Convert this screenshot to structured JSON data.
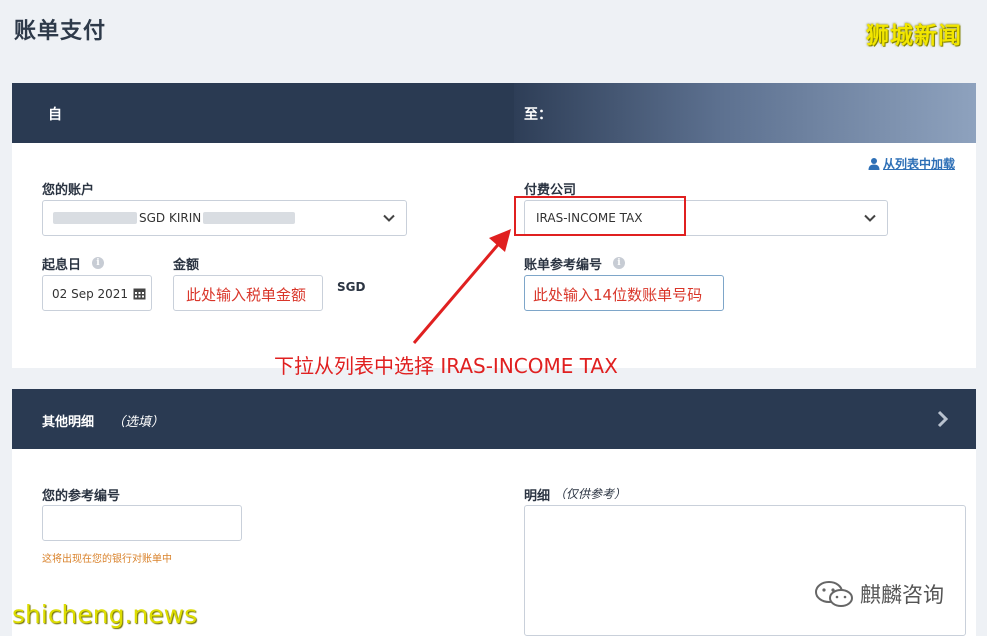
{
  "page_title": "账单支付",
  "watermark_top": "狮城新闻",
  "from_section": {
    "label": "自"
  },
  "to_section": {
    "label": "至："
  },
  "add_from_list_link": "从列表中加载",
  "account": {
    "label": "您的账户",
    "value_visible": "SGD KIRIN"
  },
  "payee": {
    "label": "付费公司",
    "value": "IRAS-INCOME TAX"
  },
  "start_date": {
    "label": "起息日",
    "value": "02 Sep 2021"
  },
  "amount": {
    "label": "金额",
    "placeholder_note": "此处输入税单金额",
    "currency": "SGD"
  },
  "bill_ref": {
    "label": "账单参考编号",
    "placeholder_note": "此处输入14位数账单号码"
  },
  "annotation": "下拉从列表中选择 IRAS-INCOME TAX",
  "other_details": {
    "title": "其他明细",
    "optional": "（选填）"
  },
  "your_ref": {
    "label": "您的参考编号",
    "hint": "这将出现在您的银行对账单中"
  },
  "details": {
    "label": "明细",
    "note": "（仅供参考）"
  },
  "watermark_bottom_left": "shicheng.news",
  "watermark_bottom_right": "麒麟咨询",
  "colors": {
    "header_band": "#2a3a52",
    "annotation_red": "#e02020",
    "link_blue": "#2d6fb6",
    "hint_orange": "#d9822b"
  },
  "icons": [
    "info-icon",
    "chevron-down-icon",
    "calendar-icon",
    "user-icon",
    "chevron-right-icon",
    "wechat-icon"
  ]
}
